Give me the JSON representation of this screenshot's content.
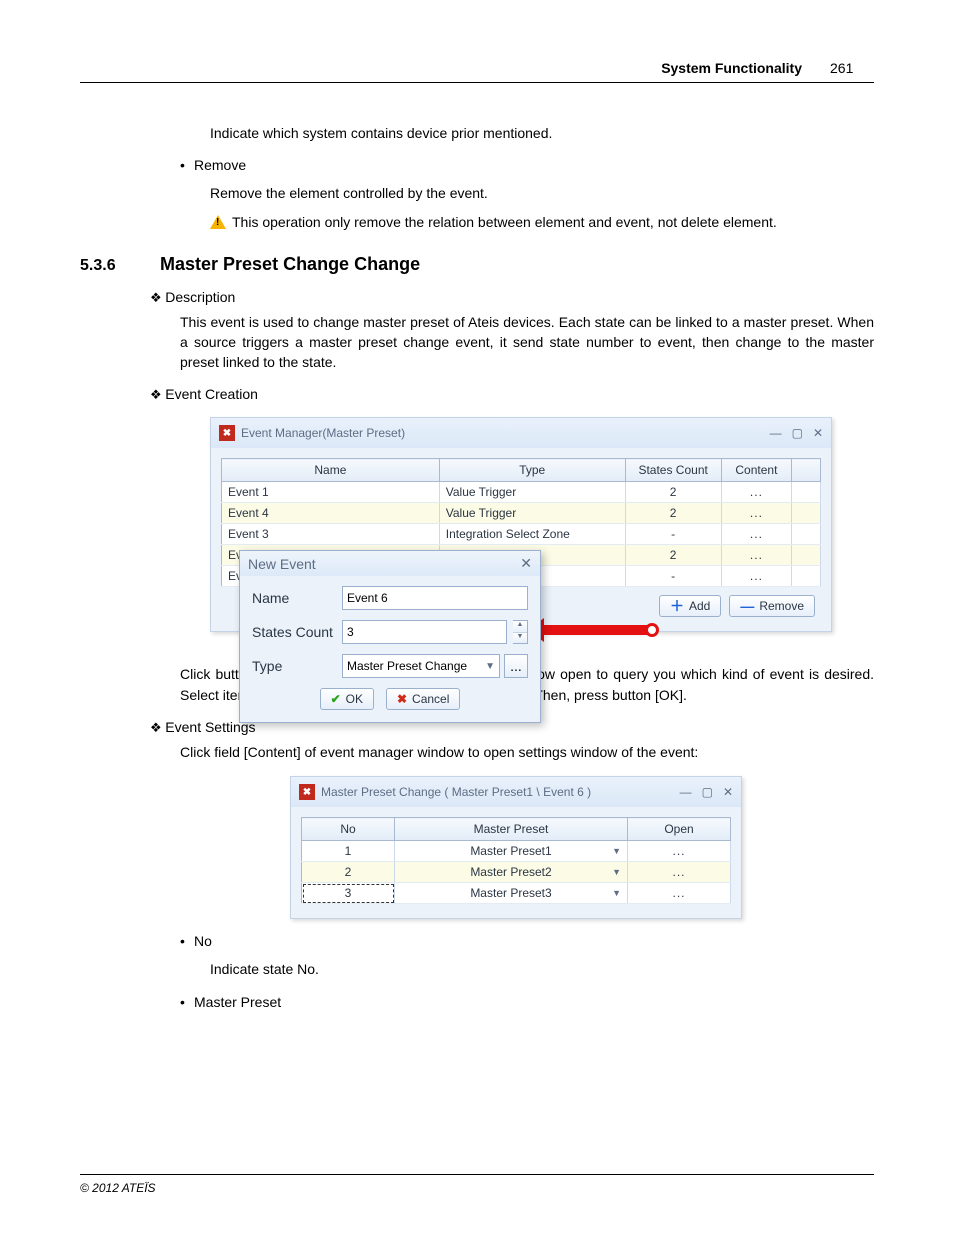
{
  "header": {
    "title": "System Functionality",
    "page": "261"
  },
  "intro": {
    "line1": "Indicate which system contains device prior mentioned."
  },
  "remove": {
    "label": "Remove",
    "text": "Remove the element controlled by the event.",
    "warn": "This operation only remove the relation between element and event, not delete element."
  },
  "section": {
    "num": "5.3.6",
    "title": "Master Preset Change Change"
  },
  "desc": {
    "heading": "Description",
    "text": "This event is used to change master preset of Ateis devices. Each state can be linked to a master preset. When a source triggers a master preset change event, it send state number to event, then change to the master preset linked to the state."
  },
  "eventCreation": {
    "heading": "Event Creation"
  },
  "evman": {
    "title": "Event Manager(Master Preset)",
    "columns": {
      "name": "Name",
      "type": "Type",
      "states": "States Count",
      "content": "Content"
    },
    "rows": [
      {
        "name": "Event 1",
        "type": "Value Trigger",
        "states": "2",
        "content": "...",
        "alt": false
      },
      {
        "name": "Event 4",
        "type": "Value Trigger",
        "states": "2",
        "content": "...",
        "alt": true
      },
      {
        "name": "Event 3",
        "type": "Integration Select Zone",
        "states": "-",
        "content": "...",
        "alt": false
      },
      {
        "name": "Even",
        "type": "",
        "states": "2",
        "content": "...",
        "alt": true
      },
      {
        "name": "Even",
        "type": "",
        "states": "-",
        "content": "...",
        "alt": false
      }
    ],
    "addBtn": "Add",
    "removeBtn": "Remove"
  },
  "newEvent": {
    "title": "New Event",
    "nameLabel": "Name",
    "nameValue": "Event 6",
    "statesLabel": "States Count",
    "statesValue": "3",
    "typeLabel": "Type",
    "typeValue": "Master Preset Change",
    "ellipsis": "...",
    "ok": "OK",
    "cancel": "Cancel"
  },
  "afterEvman": "Click button [Add] to create a new event, a second window open to query you which kind of event is desired. Select item [Master Preset Change] on Type combo box. Then, press button [OK].",
  "eventSettings": {
    "heading": "Event Settings",
    "text": "Click field [Content] of event manager window to open settings window of the event:"
  },
  "mpWin": {
    "title": "Master Preset Change ( Master Preset1 \\ Event 6 )",
    "columns": {
      "no": "No",
      "mp": "Master Preset",
      "open": "Open"
    },
    "rows": [
      {
        "no": "1",
        "mp": "Master Preset1",
        "open": "...",
        "alt": false,
        "sel": false
      },
      {
        "no": "2",
        "mp": "Master Preset2",
        "open": "...",
        "alt": true,
        "sel": false
      },
      {
        "no": "3",
        "mp": "Master Preset3",
        "open": "...",
        "alt": false,
        "sel": true
      }
    ]
  },
  "noBullet": {
    "label": "No",
    "text": "Indicate state No."
  },
  "mpBullet": {
    "label": "Master Preset"
  },
  "footer": "© 2012 ATEÏS"
}
